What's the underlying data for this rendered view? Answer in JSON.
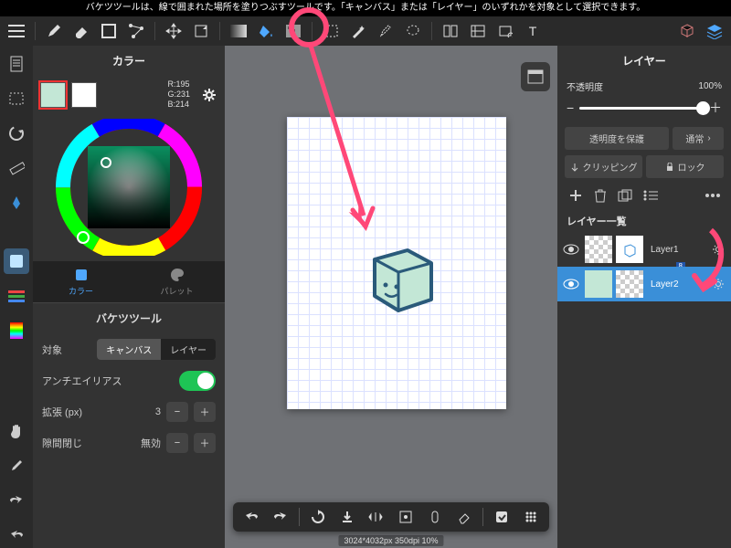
{
  "tooltip": "バケツツールは、線で囲まれた場所を塗りつぶすツールです。「キャンバス」または「レイヤー」のいずれかを対象として選択できます。",
  "color_panel": {
    "title": "カラー",
    "rgb": {
      "r": "R:195",
      "g": "G:231",
      "b": "B:214"
    },
    "tabs": {
      "color": "カラー",
      "palette": "パレット"
    }
  },
  "bucket": {
    "title": "バケツツール",
    "target_label": "対象",
    "target_canvas": "キャンバス",
    "target_layer": "レイヤー",
    "antialias": "アンチエイリアス",
    "expand_label": "拡張 (px)",
    "expand_value": "3",
    "gap_label": "隙間閉じ",
    "gap_value": "無効"
  },
  "status": "3024*4032px 350dpi 10%",
  "layer_panel": {
    "title": "レイヤー",
    "opacity_label": "不透明度",
    "opacity_value": "100%",
    "protect": "透明度を保護",
    "blend": "通常",
    "clipping": "クリッピング",
    "lock": "ロック",
    "list_title": "レイヤー一覧",
    "layers": [
      {
        "name": "Layer1",
        "badge": "8"
      },
      {
        "name": "Layer2"
      }
    ]
  }
}
